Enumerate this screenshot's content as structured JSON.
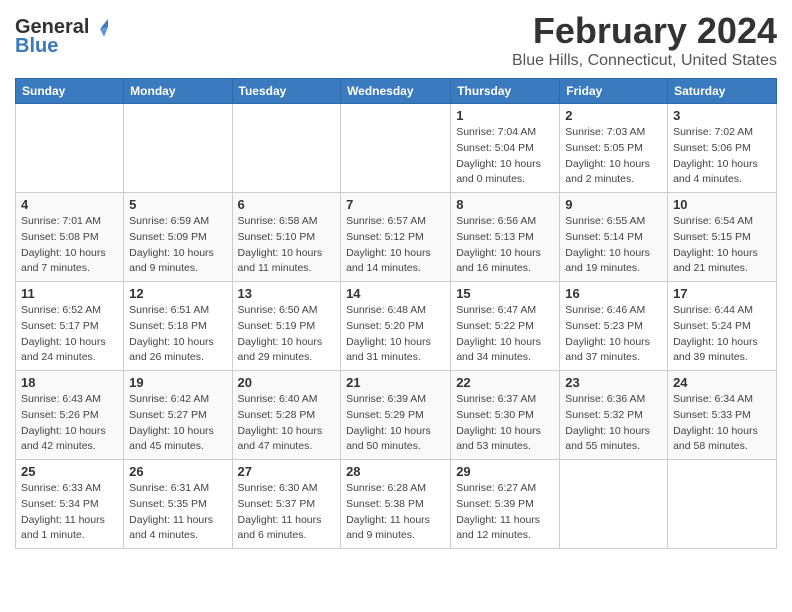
{
  "logo": {
    "general": "General",
    "blue": "Blue"
  },
  "title": "February 2024",
  "location": "Blue Hills, Connecticut, United States",
  "days_of_week": [
    "Sunday",
    "Monday",
    "Tuesday",
    "Wednesday",
    "Thursday",
    "Friday",
    "Saturday"
  ],
  "weeks": [
    [
      {
        "day": "",
        "info": ""
      },
      {
        "day": "",
        "info": ""
      },
      {
        "day": "",
        "info": ""
      },
      {
        "day": "",
        "info": ""
      },
      {
        "day": "1",
        "info": "Sunrise: 7:04 AM\nSunset: 5:04 PM\nDaylight: 10 hours\nand 0 minutes."
      },
      {
        "day": "2",
        "info": "Sunrise: 7:03 AM\nSunset: 5:05 PM\nDaylight: 10 hours\nand 2 minutes."
      },
      {
        "day": "3",
        "info": "Sunrise: 7:02 AM\nSunset: 5:06 PM\nDaylight: 10 hours\nand 4 minutes."
      }
    ],
    [
      {
        "day": "4",
        "info": "Sunrise: 7:01 AM\nSunset: 5:08 PM\nDaylight: 10 hours\nand 7 minutes."
      },
      {
        "day": "5",
        "info": "Sunrise: 6:59 AM\nSunset: 5:09 PM\nDaylight: 10 hours\nand 9 minutes."
      },
      {
        "day": "6",
        "info": "Sunrise: 6:58 AM\nSunset: 5:10 PM\nDaylight: 10 hours\nand 11 minutes."
      },
      {
        "day": "7",
        "info": "Sunrise: 6:57 AM\nSunset: 5:12 PM\nDaylight: 10 hours\nand 14 minutes."
      },
      {
        "day": "8",
        "info": "Sunrise: 6:56 AM\nSunset: 5:13 PM\nDaylight: 10 hours\nand 16 minutes."
      },
      {
        "day": "9",
        "info": "Sunrise: 6:55 AM\nSunset: 5:14 PM\nDaylight: 10 hours\nand 19 minutes."
      },
      {
        "day": "10",
        "info": "Sunrise: 6:54 AM\nSunset: 5:15 PM\nDaylight: 10 hours\nand 21 minutes."
      }
    ],
    [
      {
        "day": "11",
        "info": "Sunrise: 6:52 AM\nSunset: 5:17 PM\nDaylight: 10 hours\nand 24 minutes."
      },
      {
        "day": "12",
        "info": "Sunrise: 6:51 AM\nSunset: 5:18 PM\nDaylight: 10 hours\nand 26 minutes."
      },
      {
        "day": "13",
        "info": "Sunrise: 6:50 AM\nSunset: 5:19 PM\nDaylight: 10 hours\nand 29 minutes."
      },
      {
        "day": "14",
        "info": "Sunrise: 6:48 AM\nSunset: 5:20 PM\nDaylight: 10 hours\nand 31 minutes."
      },
      {
        "day": "15",
        "info": "Sunrise: 6:47 AM\nSunset: 5:22 PM\nDaylight: 10 hours\nand 34 minutes."
      },
      {
        "day": "16",
        "info": "Sunrise: 6:46 AM\nSunset: 5:23 PM\nDaylight: 10 hours\nand 37 minutes."
      },
      {
        "day": "17",
        "info": "Sunrise: 6:44 AM\nSunset: 5:24 PM\nDaylight: 10 hours\nand 39 minutes."
      }
    ],
    [
      {
        "day": "18",
        "info": "Sunrise: 6:43 AM\nSunset: 5:26 PM\nDaylight: 10 hours\nand 42 minutes."
      },
      {
        "day": "19",
        "info": "Sunrise: 6:42 AM\nSunset: 5:27 PM\nDaylight: 10 hours\nand 45 minutes."
      },
      {
        "day": "20",
        "info": "Sunrise: 6:40 AM\nSunset: 5:28 PM\nDaylight: 10 hours\nand 47 minutes."
      },
      {
        "day": "21",
        "info": "Sunrise: 6:39 AM\nSunset: 5:29 PM\nDaylight: 10 hours\nand 50 minutes."
      },
      {
        "day": "22",
        "info": "Sunrise: 6:37 AM\nSunset: 5:30 PM\nDaylight: 10 hours\nand 53 minutes."
      },
      {
        "day": "23",
        "info": "Sunrise: 6:36 AM\nSunset: 5:32 PM\nDaylight: 10 hours\nand 55 minutes."
      },
      {
        "day": "24",
        "info": "Sunrise: 6:34 AM\nSunset: 5:33 PM\nDaylight: 10 hours\nand 58 minutes."
      }
    ],
    [
      {
        "day": "25",
        "info": "Sunrise: 6:33 AM\nSunset: 5:34 PM\nDaylight: 11 hours\nand 1 minute."
      },
      {
        "day": "26",
        "info": "Sunrise: 6:31 AM\nSunset: 5:35 PM\nDaylight: 11 hours\nand 4 minutes."
      },
      {
        "day": "27",
        "info": "Sunrise: 6:30 AM\nSunset: 5:37 PM\nDaylight: 11 hours\nand 6 minutes."
      },
      {
        "day": "28",
        "info": "Sunrise: 6:28 AM\nSunset: 5:38 PM\nDaylight: 11 hours\nand 9 minutes."
      },
      {
        "day": "29",
        "info": "Sunrise: 6:27 AM\nSunset: 5:39 PM\nDaylight: 11 hours\nand 12 minutes."
      },
      {
        "day": "",
        "info": ""
      },
      {
        "day": "",
        "info": ""
      }
    ]
  ]
}
